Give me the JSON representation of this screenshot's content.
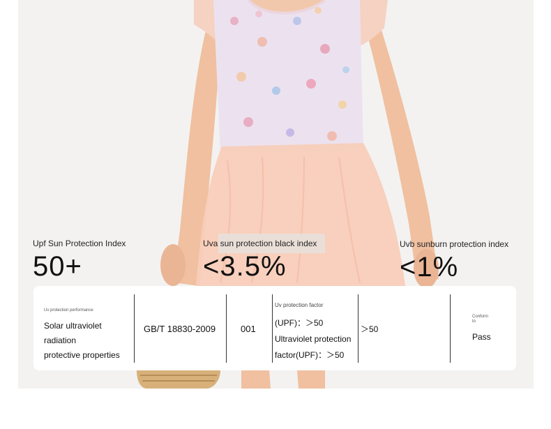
{
  "stats": {
    "upf": {
      "label": "Upf Sun Protection Index",
      "value": "50+"
    },
    "uva": {
      "label": "Uva sun protection black index",
      "value": "<3.5%"
    },
    "uvb": {
      "label": "Uvb sunburn protection index",
      "value": "<1%"
    }
  },
  "spec": {
    "category_caption": "Uv protection performance",
    "category_line1": "Solar ultraviolet radiation",
    "category_line2": "protective properties",
    "standard": "GB/T 18830-2009",
    "sample": "001",
    "factor_caption": "Uv protection factor",
    "factor_line1": "(UPF)：＞50",
    "factor_line2": "Ultraviolet protection",
    "factor_line3": "factor(UPF)：＞50",
    "result_value": "＞50",
    "conform_caption_1": "Conform",
    "conform_caption_2": "to",
    "verdict": "Pass"
  },
  "colors": {
    "background": "#f3f2f1",
    "skin": "#f2c2a2",
    "tulle": "#f8cdb9",
    "card": "#ffffff"
  }
}
